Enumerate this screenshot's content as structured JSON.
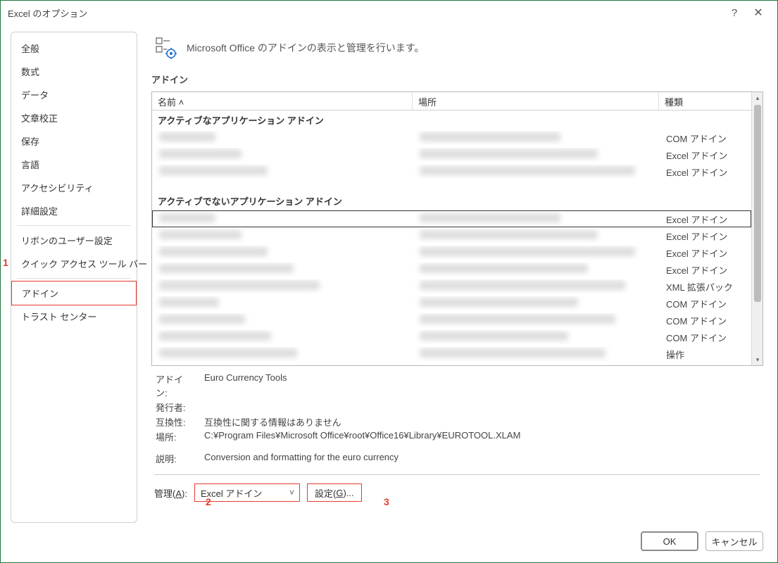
{
  "title": "Excel のオプション",
  "sidebar": {
    "groups": [
      {
        "items": [
          "全般",
          "数式",
          "データ",
          "文章校正",
          "保存",
          "言語",
          "アクセシビリティ",
          "詳細設定"
        ]
      },
      {
        "items": [
          "リボンのユーザー設定",
          "クイック アクセス ツール バー"
        ]
      },
      {
        "items": [
          "アドイン",
          "トラスト センター"
        ]
      }
    ],
    "selected": "アドイン"
  },
  "main": {
    "headerText": "Microsoft Office のアドインの表示と管理を行います。",
    "sectionTitle": "アドイン",
    "columns": {
      "name": "名前 ˄",
      "location": "場所",
      "type": "種類"
    },
    "groups": [
      {
        "label": "アクティブなアプリケーション アドイン",
        "rows": [
          {
            "type": "COM アドイン"
          },
          {
            "type": "Excel アドイン"
          },
          {
            "type": "Excel アドイン"
          }
        ]
      },
      {
        "label": "アクティブでないアプリケーション アドイン",
        "rows": [
          {
            "type": "Excel アドイン",
            "focused": true
          },
          {
            "type": "Excel アドイン"
          },
          {
            "type": "Excel アドイン"
          },
          {
            "type": "Excel アドイン"
          },
          {
            "type": "XML 拡張パック"
          },
          {
            "type": "COM アドイン"
          },
          {
            "type": "COM アドイン"
          },
          {
            "type": "COM アドイン"
          },
          {
            "type": "操作"
          }
        ]
      }
    ],
    "detail": {
      "addinLabel": "アドイン:",
      "addinValue": "Euro Currency Tools",
      "publisherLabel": "発行者:",
      "publisherValue": "",
      "compatLabel": "互換性:",
      "compatValue": "互換性に関する情報はありません",
      "locationLabel": "場所:",
      "locationValue": "C:¥Program Files¥Microsoft Office¥root¥Office16¥Library¥EUROTOOL.XLAM",
      "descLabel": "説明:",
      "descValue": "Conversion and formatting for the euro currency"
    },
    "manage": {
      "label": "管理(A):",
      "selected": "Excel アドイン",
      "goLabel": "設定(G)..."
    }
  },
  "buttons": {
    "ok": "OK",
    "cancel": "キャンセル"
  },
  "callouts": {
    "c1": "1",
    "c2": "2",
    "c3": "3"
  }
}
